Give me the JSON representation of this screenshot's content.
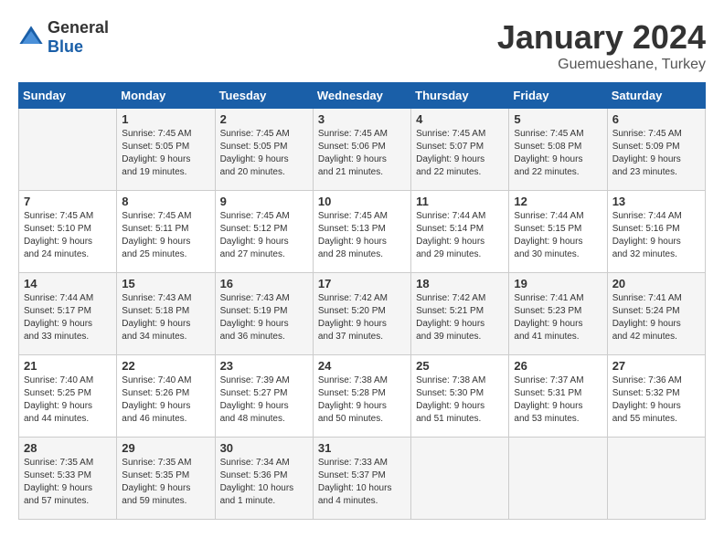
{
  "header": {
    "logo_general": "General",
    "logo_blue": "Blue",
    "title": "January 2024",
    "location": "Guemueshane, Turkey"
  },
  "calendar": {
    "days_of_week": [
      "Sunday",
      "Monday",
      "Tuesday",
      "Wednesday",
      "Thursday",
      "Friday",
      "Saturday"
    ],
    "weeks": [
      [
        {
          "day": "",
          "info": ""
        },
        {
          "day": "1",
          "info": "Sunrise: 7:45 AM\nSunset: 5:05 PM\nDaylight: 9 hours\nand 19 minutes."
        },
        {
          "day": "2",
          "info": "Sunrise: 7:45 AM\nSunset: 5:05 PM\nDaylight: 9 hours\nand 20 minutes."
        },
        {
          "day": "3",
          "info": "Sunrise: 7:45 AM\nSunset: 5:06 PM\nDaylight: 9 hours\nand 21 minutes."
        },
        {
          "day": "4",
          "info": "Sunrise: 7:45 AM\nSunset: 5:07 PM\nDaylight: 9 hours\nand 22 minutes."
        },
        {
          "day": "5",
          "info": "Sunrise: 7:45 AM\nSunset: 5:08 PM\nDaylight: 9 hours\nand 22 minutes."
        },
        {
          "day": "6",
          "info": "Sunrise: 7:45 AM\nSunset: 5:09 PM\nDaylight: 9 hours\nand 23 minutes."
        }
      ],
      [
        {
          "day": "7",
          "info": "Sunrise: 7:45 AM\nSunset: 5:10 PM\nDaylight: 9 hours\nand 24 minutes."
        },
        {
          "day": "8",
          "info": "Sunrise: 7:45 AM\nSunset: 5:11 PM\nDaylight: 9 hours\nand 25 minutes."
        },
        {
          "day": "9",
          "info": "Sunrise: 7:45 AM\nSunset: 5:12 PM\nDaylight: 9 hours\nand 27 minutes."
        },
        {
          "day": "10",
          "info": "Sunrise: 7:45 AM\nSunset: 5:13 PM\nDaylight: 9 hours\nand 28 minutes."
        },
        {
          "day": "11",
          "info": "Sunrise: 7:44 AM\nSunset: 5:14 PM\nDaylight: 9 hours\nand 29 minutes."
        },
        {
          "day": "12",
          "info": "Sunrise: 7:44 AM\nSunset: 5:15 PM\nDaylight: 9 hours\nand 30 minutes."
        },
        {
          "day": "13",
          "info": "Sunrise: 7:44 AM\nSunset: 5:16 PM\nDaylight: 9 hours\nand 32 minutes."
        }
      ],
      [
        {
          "day": "14",
          "info": "Sunrise: 7:44 AM\nSunset: 5:17 PM\nDaylight: 9 hours\nand 33 minutes."
        },
        {
          "day": "15",
          "info": "Sunrise: 7:43 AM\nSunset: 5:18 PM\nDaylight: 9 hours\nand 34 minutes."
        },
        {
          "day": "16",
          "info": "Sunrise: 7:43 AM\nSunset: 5:19 PM\nDaylight: 9 hours\nand 36 minutes."
        },
        {
          "day": "17",
          "info": "Sunrise: 7:42 AM\nSunset: 5:20 PM\nDaylight: 9 hours\nand 37 minutes."
        },
        {
          "day": "18",
          "info": "Sunrise: 7:42 AM\nSunset: 5:21 PM\nDaylight: 9 hours\nand 39 minutes."
        },
        {
          "day": "19",
          "info": "Sunrise: 7:41 AM\nSunset: 5:23 PM\nDaylight: 9 hours\nand 41 minutes."
        },
        {
          "day": "20",
          "info": "Sunrise: 7:41 AM\nSunset: 5:24 PM\nDaylight: 9 hours\nand 42 minutes."
        }
      ],
      [
        {
          "day": "21",
          "info": "Sunrise: 7:40 AM\nSunset: 5:25 PM\nDaylight: 9 hours\nand 44 minutes."
        },
        {
          "day": "22",
          "info": "Sunrise: 7:40 AM\nSunset: 5:26 PM\nDaylight: 9 hours\nand 46 minutes."
        },
        {
          "day": "23",
          "info": "Sunrise: 7:39 AM\nSunset: 5:27 PM\nDaylight: 9 hours\nand 48 minutes."
        },
        {
          "day": "24",
          "info": "Sunrise: 7:38 AM\nSunset: 5:28 PM\nDaylight: 9 hours\nand 50 minutes."
        },
        {
          "day": "25",
          "info": "Sunrise: 7:38 AM\nSunset: 5:30 PM\nDaylight: 9 hours\nand 51 minutes."
        },
        {
          "day": "26",
          "info": "Sunrise: 7:37 AM\nSunset: 5:31 PM\nDaylight: 9 hours\nand 53 minutes."
        },
        {
          "day": "27",
          "info": "Sunrise: 7:36 AM\nSunset: 5:32 PM\nDaylight: 9 hours\nand 55 minutes."
        }
      ],
      [
        {
          "day": "28",
          "info": "Sunrise: 7:35 AM\nSunset: 5:33 PM\nDaylight: 9 hours\nand 57 minutes."
        },
        {
          "day": "29",
          "info": "Sunrise: 7:35 AM\nSunset: 5:35 PM\nDaylight: 9 hours\nand 59 minutes."
        },
        {
          "day": "30",
          "info": "Sunrise: 7:34 AM\nSunset: 5:36 PM\nDaylight: 10 hours\nand 1 minute."
        },
        {
          "day": "31",
          "info": "Sunrise: 7:33 AM\nSunset: 5:37 PM\nDaylight: 10 hours\nand 4 minutes."
        },
        {
          "day": "",
          "info": ""
        },
        {
          "day": "",
          "info": ""
        },
        {
          "day": "",
          "info": ""
        }
      ]
    ]
  }
}
